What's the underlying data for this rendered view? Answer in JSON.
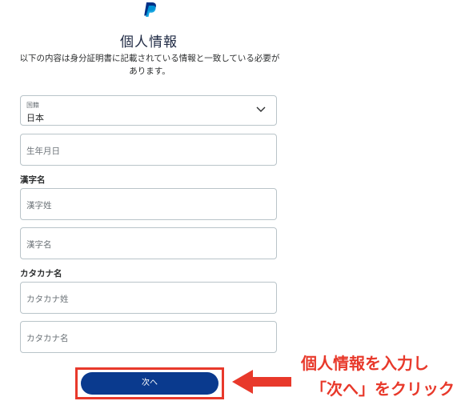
{
  "header": {
    "logo": "paypal-logo",
    "title": "個人情報",
    "description": "以下の内容は身分証明書に記載されている情報と一致している必要があります。"
  },
  "form": {
    "country": {
      "label": "国籍",
      "value": "日本"
    },
    "birthdate_placeholder": "生年月日",
    "kanji_section_label": "漢字名",
    "kanji_last_placeholder": "漢字姓",
    "kanji_first_placeholder": "漢字名",
    "kana_section_label": "カタカナ名",
    "kana_last_placeholder": "カタカナ姓",
    "kana_first_placeholder": "カタカナ名",
    "next_label": "次へ"
  },
  "annotation": {
    "line1": "個人情報を入力し",
    "line2": "「次へ」をクリック",
    "color": "#e8392b"
  },
  "colors": {
    "primary_button": "#0a3a8e",
    "highlight": "#e8392b"
  }
}
